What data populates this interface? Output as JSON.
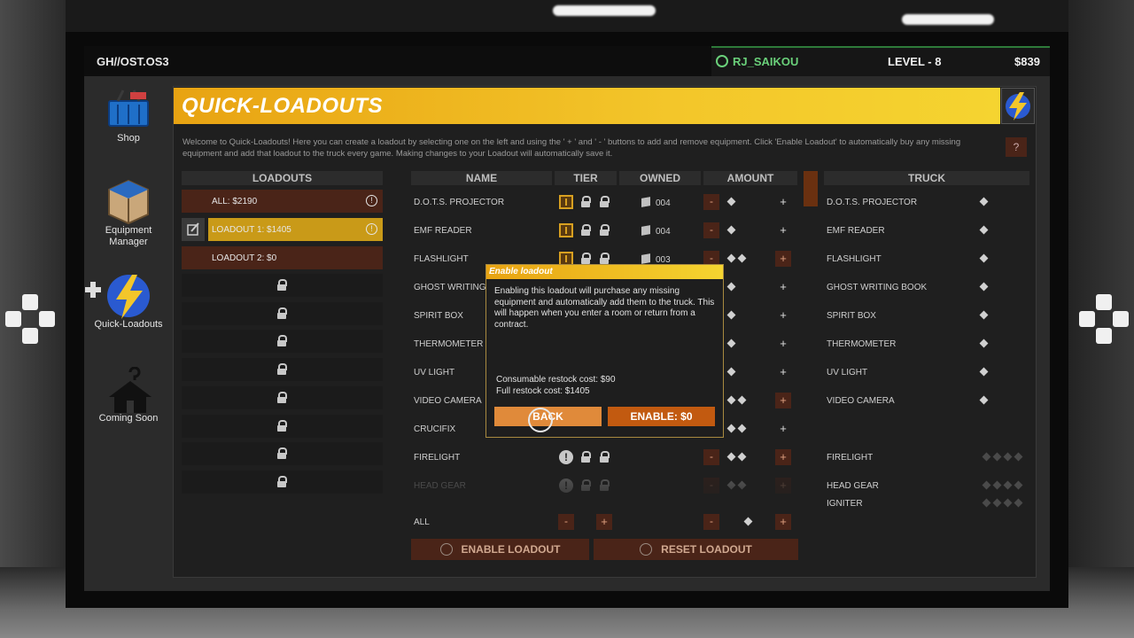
{
  "topbar": {
    "system": "GH//OST.OS3",
    "username": "RJ_SAIKOU",
    "level": "LEVEL  - 8",
    "money": "$839"
  },
  "sidenav": [
    {
      "label": "Shop",
      "icon": "basket-icon"
    },
    {
      "label": "Equipment\nManager",
      "icon": "box-icon"
    },
    {
      "label": "Quick-Loadouts",
      "icon": "lightning-icon"
    },
    {
      "label": "Coming Soon",
      "icon": "hanger-icon"
    }
  ],
  "header": {
    "title": "QUICK-LOADOUTS",
    "help": "?",
    "intro": "Welcome to Quick-Loadouts! Here you can create a loadout by selecting one on the left and using the ' + ' and ' - ' buttons to add and remove equipment. Click 'Enable Loadout' to automatically buy any missing equipment and add that loadout to the truck every game. Making changes to your Loadout will automatically save it."
  },
  "columns": {
    "loadouts": "LOADOUTS",
    "name": "NAME",
    "tier": "TIER",
    "owned": "OWNED",
    "amount": "AMOUNT",
    "truck": "TRUCK"
  },
  "loadouts": [
    {
      "label": "ALL: $2190",
      "state": "normal"
    },
    {
      "label": "LOADOUT 1: $1405",
      "state": "selected"
    },
    {
      "label": "LOADOUT 2: $0",
      "state": "normal"
    }
  ],
  "locked_slots": 8,
  "equipment": [
    {
      "name": "D.O.T.S. PROJECTOR",
      "owned": "004"
    },
    {
      "name": "EMF READER",
      "owned": "004"
    },
    {
      "name": "FLASHLIGHT",
      "owned": "003"
    },
    {
      "name": "GHOST WRITING B",
      "owned": ""
    },
    {
      "name": "SPIRIT BOX",
      "owned": ""
    },
    {
      "name": "THERMOMETER",
      "owned": ""
    },
    {
      "name": "UV LIGHT",
      "owned": ""
    },
    {
      "name": "VIDEO CAMERA",
      "owned": ""
    },
    {
      "name": "CRUCIFIX",
      "owned": ""
    },
    {
      "name": "FIRELIGHT",
      "owned": ""
    },
    {
      "name": "HEAD GEAR",
      "owned": ""
    }
  ],
  "all_row": {
    "label": "ALL",
    "minus": "-",
    "plus": "+"
  },
  "truck": [
    "D.O.T.S. PROJECTOR",
    "EMF READER",
    "FLASHLIGHT",
    "GHOST WRITING BOOK",
    "SPIRIT BOX",
    "THERMOMETER",
    "UV LIGHT",
    "VIDEO CAMERA",
    "",
    "FIRELIGHT",
    "HEAD GEAR",
    "IGNITER"
  ],
  "buttons": {
    "enable_loadout": "ENABLE LOADOUT",
    "reset_loadout": "RESET LOADOUT"
  },
  "modal": {
    "title": "Enable loadout",
    "body": "Enabling this loadout will purchase any missing equipment and automatically add them to the truck. This will happen when you enter a room or return from a contract.",
    "consumable_cost": "Consumable restock cost: $90",
    "full_cost": "Full restock cost: $1405",
    "back": "BACK",
    "enable": "ENABLE: $0"
  },
  "colors": {
    "accent_yellow": "#f3c62a",
    "accent_orange": "#e08030",
    "dark_red": "#4a2418",
    "online_green": "#6ad07a"
  }
}
